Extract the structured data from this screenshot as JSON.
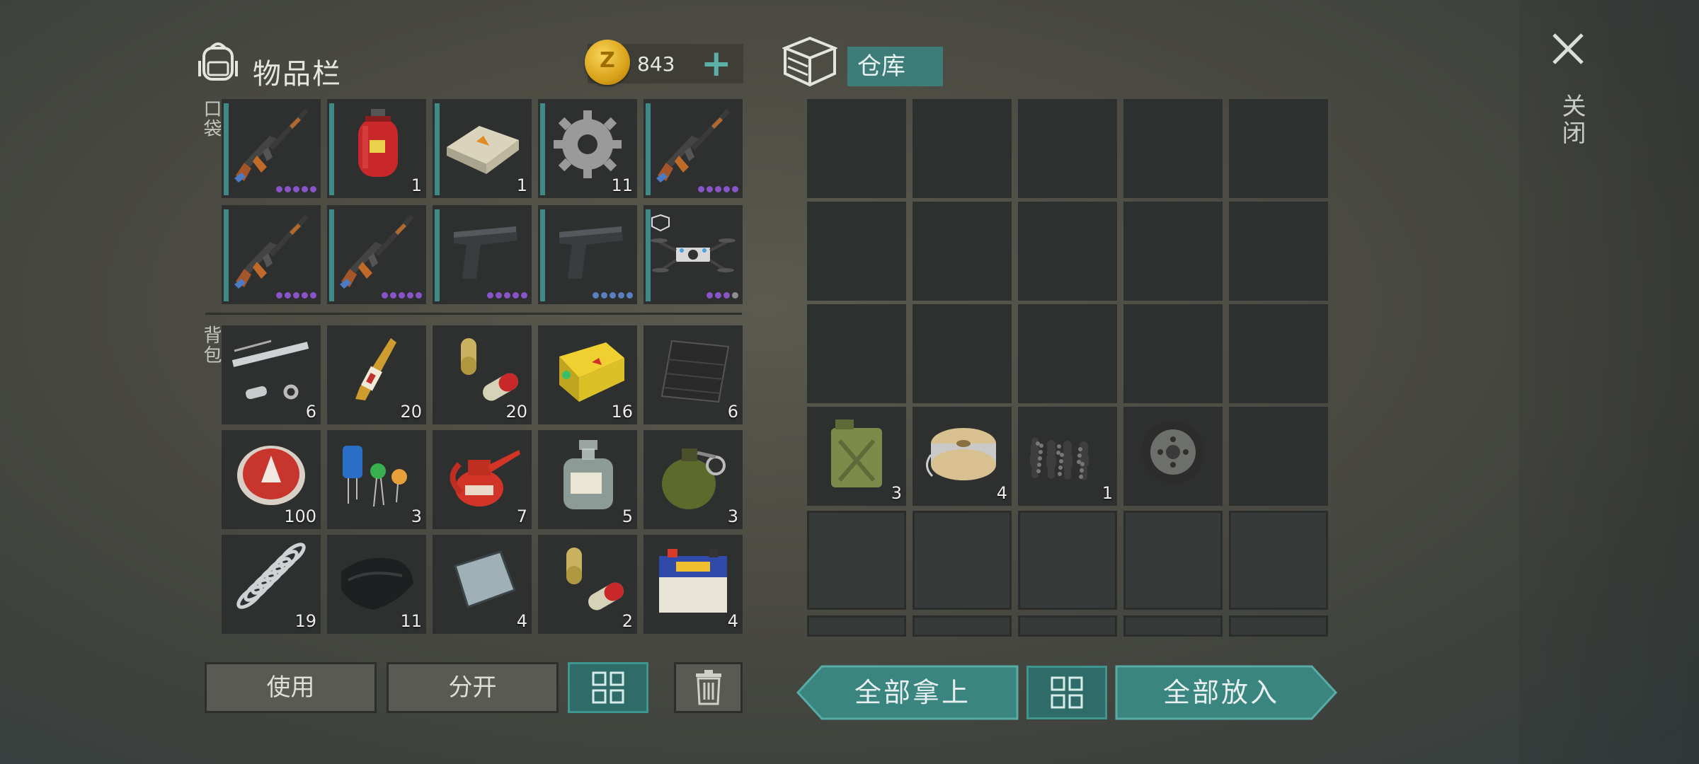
{
  "header": {
    "inventory_title": "物品栏",
    "coins": "843",
    "coin_plus": "+",
    "warehouse_tab": "仓库",
    "close_label": "关闭"
  },
  "sections": {
    "pockets": "口袋",
    "backpack": "背包"
  },
  "pockets": [
    {
      "icon": "assault-rifle-icon",
      "dots": [
        "p",
        "p",
        "p",
        "p",
        "p"
      ]
    },
    {
      "icon": "gas-cylinder-icon",
      "qty": "1"
    },
    {
      "icon": "explosive-block-icon",
      "qty": "1"
    },
    {
      "icon": "gear-icon",
      "qty": "11"
    },
    {
      "icon": "assault-rifle-icon",
      "dots": [
        "p",
        "p",
        "p",
        "p",
        "p"
      ]
    },
    {
      "icon": "assault-rifle-icon",
      "dots": [
        "p",
        "p",
        "p",
        "p",
        "p"
      ]
    },
    {
      "icon": "assault-rifle-icon",
      "dots": [
        "p",
        "p",
        "p",
        "p",
        "p"
      ]
    },
    {
      "icon": "pistol-icon",
      "dots": [
        "p",
        "p",
        "p",
        "p",
        "p"
      ]
    },
    {
      "icon": "pistol-icon",
      "dots": [
        "b",
        "b",
        "b",
        "b",
        "b"
      ]
    },
    {
      "icon": "drone-icon",
      "dots": [
        "p",
        "p",
        "p",
        "g"
      ]
    }
  ],
  "backpack": [
    {
      "icon": "gun-barrel-parts-icon",
      "qty": "6"
    },
    {
      "icon": "ampoule-icon",
      "qty": "20"
    },
    {
      "icon": "capsule-pills-icon",
      "qty": "20"
    },
    {
      "icon": "battery-pack-icon",
      "qty": "16"
    },
    {
      "icon": "carbon-mesh-icon",
      "qty": "6"
    },
    {
      "icon": "bottle-cap-icon",
      "qty": "100"
    },
    {
      "icon": "electronic-components-icon",
      "qty": "3"
    },
    {
      "icon": "oil-can-icon",
      "qty": "7"
    },
    {
      "icon": "chemical-bottle-icon",
      "qty": "5"
    },
    {
      "icon": "grenade-icon",
      "qty": "3"
    },
    {
      "icon": "spring-icon",
      "qty": "19"
    },
    {
      "icon": "cloth-icon",
      "qty": "11"
    },
    {
      "icon": "metal-plate-icon",
      "qty": "4"
    },
    {
      "icon": "capsule-pills-icon",
      "qty": "2"
    },
    {
      "icon": "car-battery-icon",
      "qty": "4"
    }
  ],
  "warehouse": [
    {
      "icon": "jerrycan-icon",
      "qty": "3"
    },
    {
      "icon": "wire-spool-icon",
      "qty": "4"
    },
    {
      "icon": "gravel-pile-icon",
      "qty": "1"
    },
    {
      "icon": "wheel-icon"
    }
  ],
  "buttons": {
    "use": "使用",
    "split": "分开",
    "take_all": "全部拿上",
    "put_all": "全部放入"
  },
  "colors": {
    "accent": "#3f8a86",
    "purple_dot": "#8a54c9",
    "coin": "#e0a820"
  }
}
